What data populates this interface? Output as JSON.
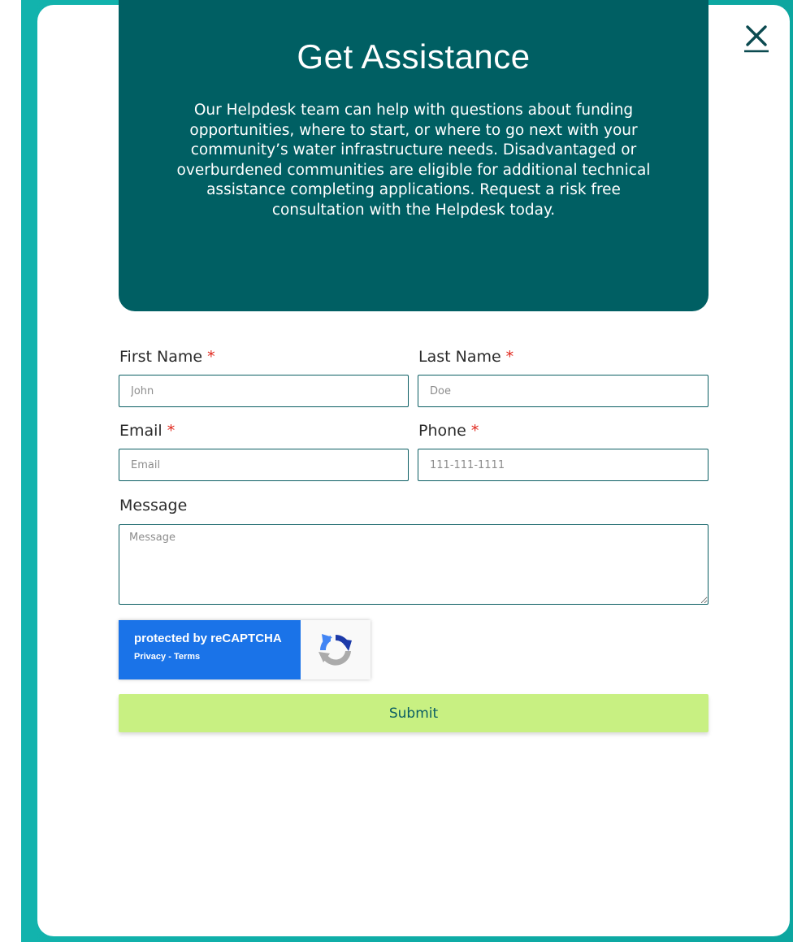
{
  "modal": {
    "close_label": "Close"
  },
  "hero": {
    "title": "Get Assistance",
    "description": "Our Helpdesk team can help with questions about funding opportunities, where to start, or where to go next with your community’s water infrastructure needs. Disadvantaged or overburdened communities are eligible for additional technical assistance completing applications. Request a risk free consultation with the Helpdesk today."
  },
  "form": {
    "first_name": {
      "label": "First Name",
      "required_mark": "*",
      "placeholder": "John"
    },
    "last_name": {
      "label": "Last Name",
      "required_mark": "*",
      "placeholder": "Doe"
    },
    "email": {
      "label": "Email",
      "required_mark": "*",
      "placeholder": "Email"
    },
    "phone": {
      "label": "Phone",
      "required_mark": "*",
      "placeholder": "111-111-1111"
    },
    "message": {
      "label": "Message",
      "placeholder": "Message"
    },
    "submit_label": "Submit"
  },
  "recaptcha": {
    "title": "protected by reCAPTCHA",
    "privacy": "Privacy",
    "separator": " - ",
    "terms": "Terms",
    "icon": "recaptcha-logo-icon"
  },
  "colors": {
    "backdrop": "#12b3ad",
    "hero": "#005f63",
    "submit": "#c8f082",
    "accent": "#0b5e63",
    "required": "#e0261b",
    "recaptcha": "#1a73e8"
  }
}
